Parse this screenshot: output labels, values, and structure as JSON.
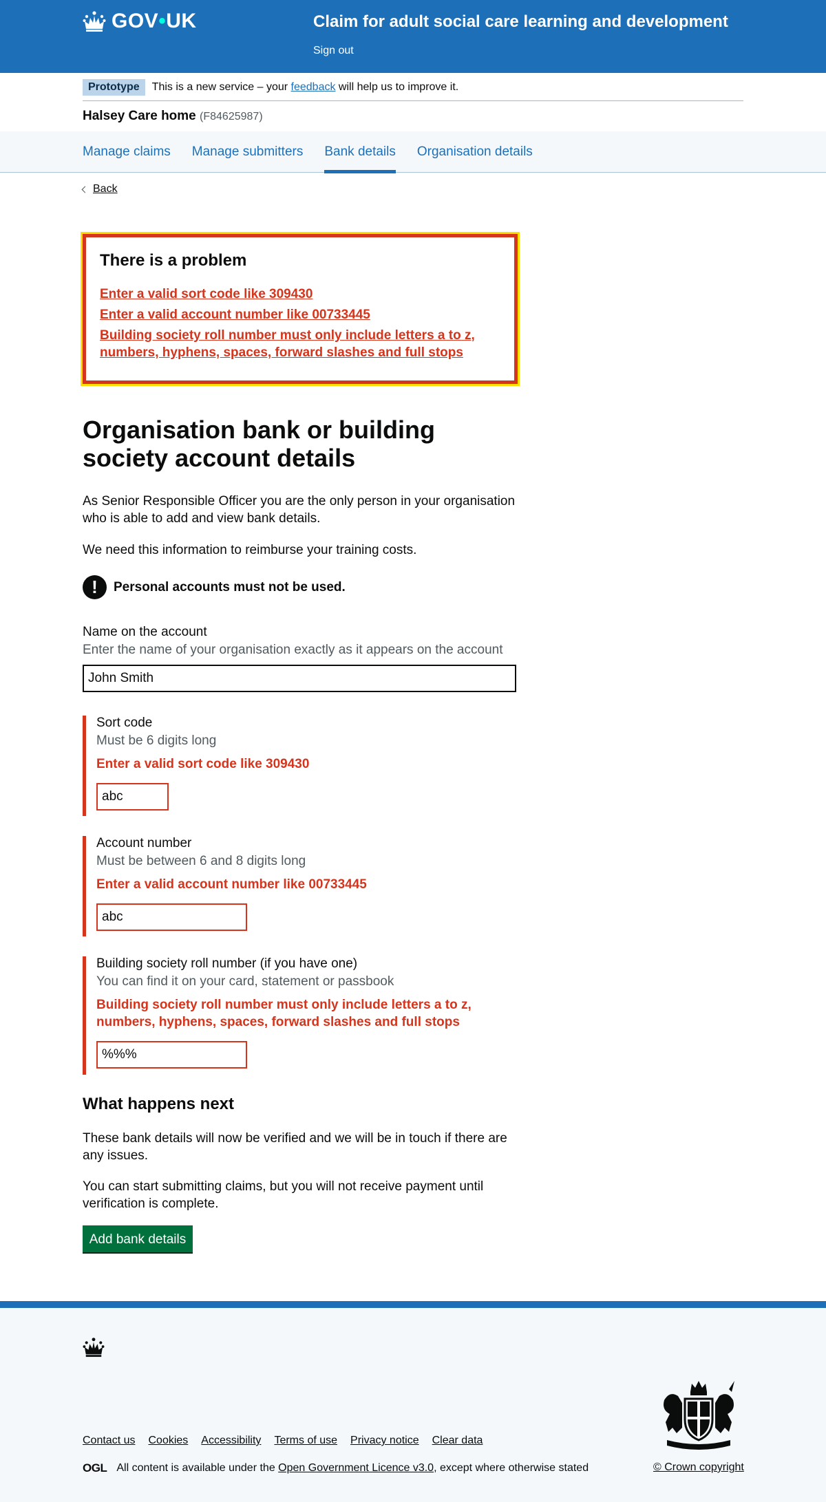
{
  "header": {
    "logo_text_a": "GOV",
    "logo_dot": "•",
    "logo_text_b": "UK",
    "service_name": "Claim for adult social care learning and development",
    "sign_out": "Sign out"
  },
  "phase_banner": {
    "tag": "Prototype",
    "text_before": "This is a new service – your",
    "link": "feedback",
    "text_after": "will help us to improve it."
  },
  "organisation": {
    "name": "Halsey Care home",
    "id": "(F84625987)"
  },
  "subnav": [
    {
      "label": "Manage claims",
      "active": false
    },
    {
      "label": "Manage submitters",
      "active": false
    },
    {
      "label": "Bank details",
      "active": true
    },
    {
      "label": "Organisation details",
      "active": false
    }
  ],
  "back_link": "Back",
  "error_summary": {
    "title": "There is a problem",
    "errors": [
      "Enter a valid sort code like 309430",
      "Enter a valid account number like 00733445",
      "Building society roll number must only include letters a to z, numbers, hyphens, spaces, forward slashes and full stops"
    ]
  },
  "page": {
    "title": "Organisation bank or building society account details",
    "intro_1": "As Senior Responsible Officer you are the only person in your organisation who is able to add and view bank details.",
    "intro_2": "We need this information to reimburse your training costs.",
    "warning_icon": "!",
    "warning": "Personal accounts must not be used."
  },
  "fields": {
    "name": {
      "label": "Name on the account",
      "hint": "Enter the name of your organisation exactly as it appears on the account",
      "value": "John Smith"
    },
    "sort_code": {
      "label": "Sort code",
      "hint": "Must be 6 digits long",
      "error": "Enter a valid sort code like 309430",
      "value": "abc"
    },
    "account_number": {
      "label": "Account number",
      "hint": "Must be between 6 and 8 digits long",
      "error": "Enter a valid account number like 00733445",
      "value": "abc"
    },
    "roll_number": {
      "label": "Building society roll number (if you have one)",
      "hint": "You can find it on your card, statement or passbook",
      "error": "Building society roll number must only include letters a to z, numbers, hyphens, spaces, forward slashes and full stops",
      "value": "%%%"
    }
  },
  "next": {
    "title": "What happens next",
    "p1": "These bank details will now be verified and we will be in touch if there are any issues.",
    "p2": "You can start submitting claims, but you will not receive payment until verification is complete.",
    "button": "Add bank details"
  },
  "footer": {
    "links": [
      "Contact us",
      "Cookies",
      "Accessibility",
      "Terms of use",
      "Privacy notice",
      "Clear data"
    ],
    "ogl_mark": "OGL",
    "licence_before": "All content is available under the",
    "licence_link": "Open Government Licence v3.0",
    "licence_after": ", except where otherwise stated",
    "copyright": "© Crown copyright"
  },
  "colors": {
    "brand_blue": "#1d70b8",
    "error_red": "#d4351c",
    "focus_yellow": "#ffdd00",
    "button_green": "#00703c"
  }
}
